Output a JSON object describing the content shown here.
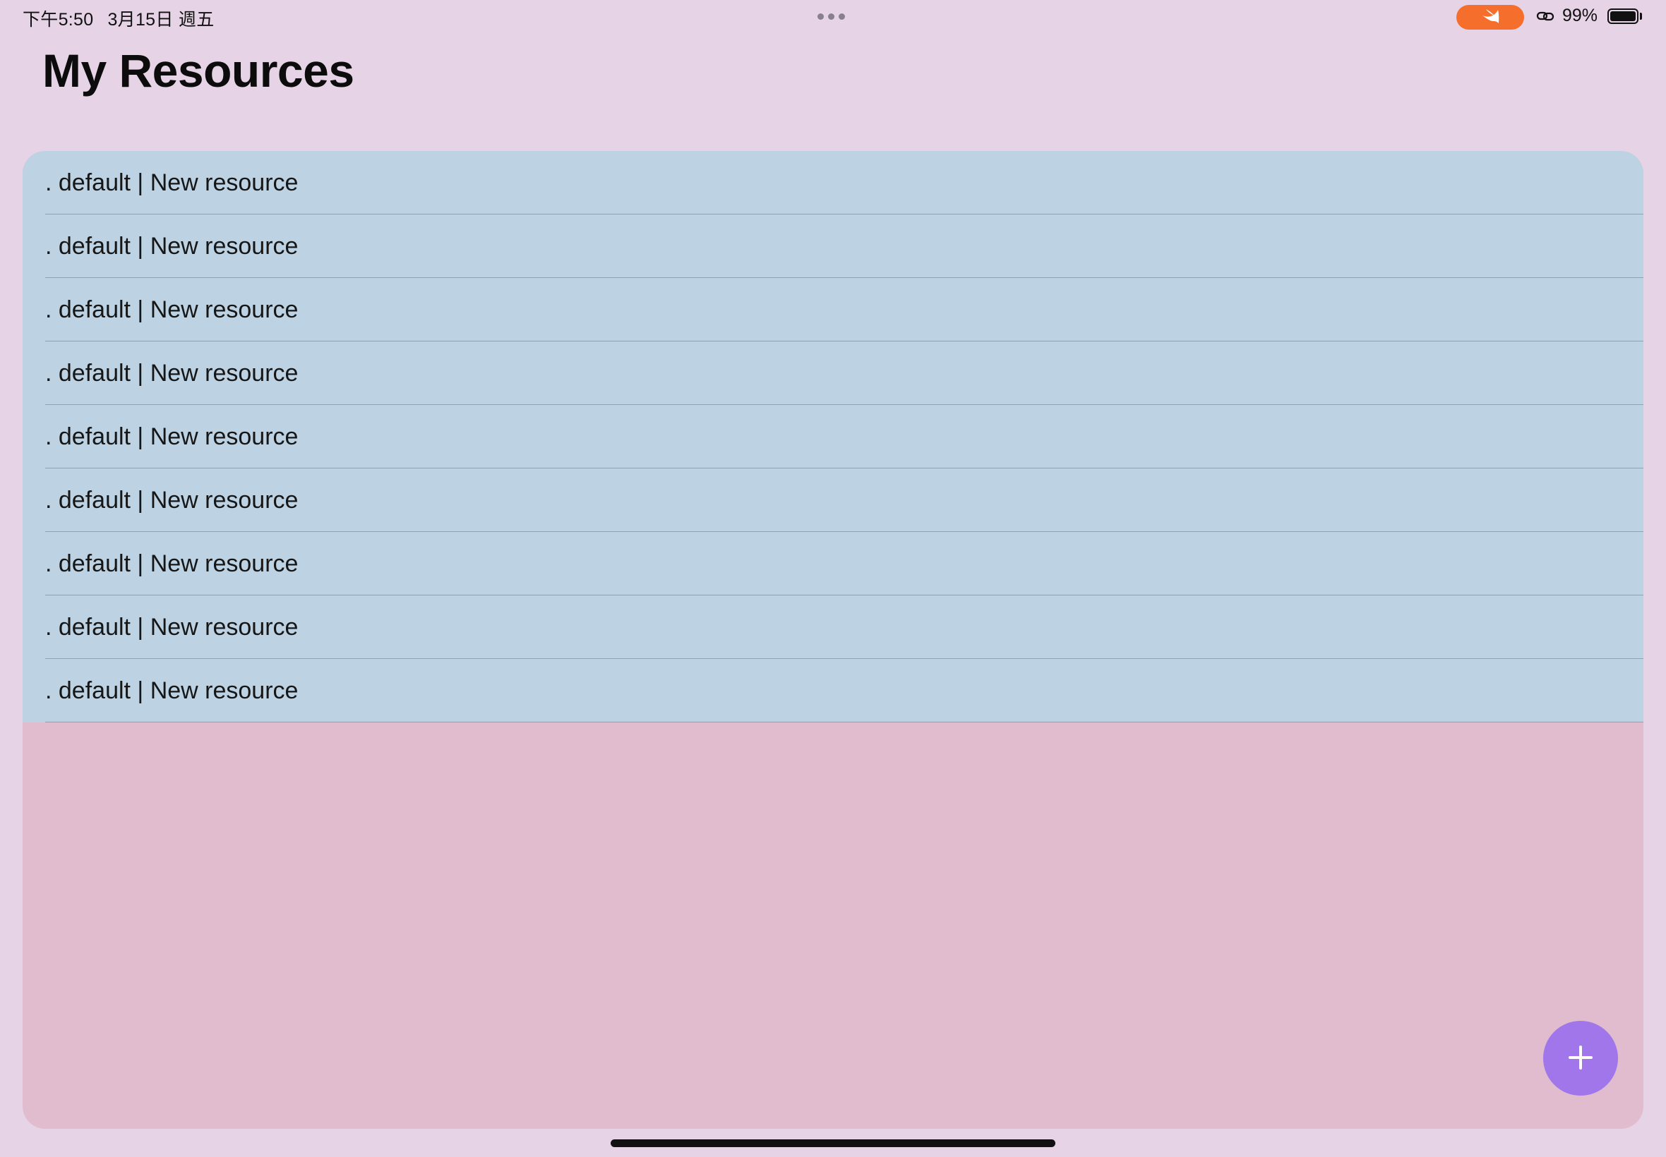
{
  "status_bar": {
    "time": "下午5:50",
    "date": "3月15日 週五",
    "battery_percent": "99%",
    "battery_level": 0.99,
    "icons": [
      "multitasking-dots-icon",
      "swift-app-icon",
      "link-icon",
      "battery-icon"
    ],
    "swift_pill_color": "#f56e2c"
  },
  "page": {
    "title": "My Resources"
  },
  "resources": [
    {
      "label": ". default | New resource"
    },
    {
      "label": ". default | New resource"
    },
    {
      "label": ". default | New resource"
    },
    {
      "label": ". default | New resource"
    },
    {
      "label": ". default | New resource"
    },
    {
      "label": ". default | New resource"
    },
    {
      "label": ". default | New resource"
    },
    {
      "label": ". default | New resource"
    },
    {
      "label": ". default | New resource"
    }
  ],
  "fab": {
    "icon": "plus-icon",
    "color": "#a076ea"
  },
  "colors": {
    "background": "#e6d3e6",
    "list_background": "#bdd3e3",
    "card_background": "#e1bcce",
    "separator": "#b98ea6"
  }
}
